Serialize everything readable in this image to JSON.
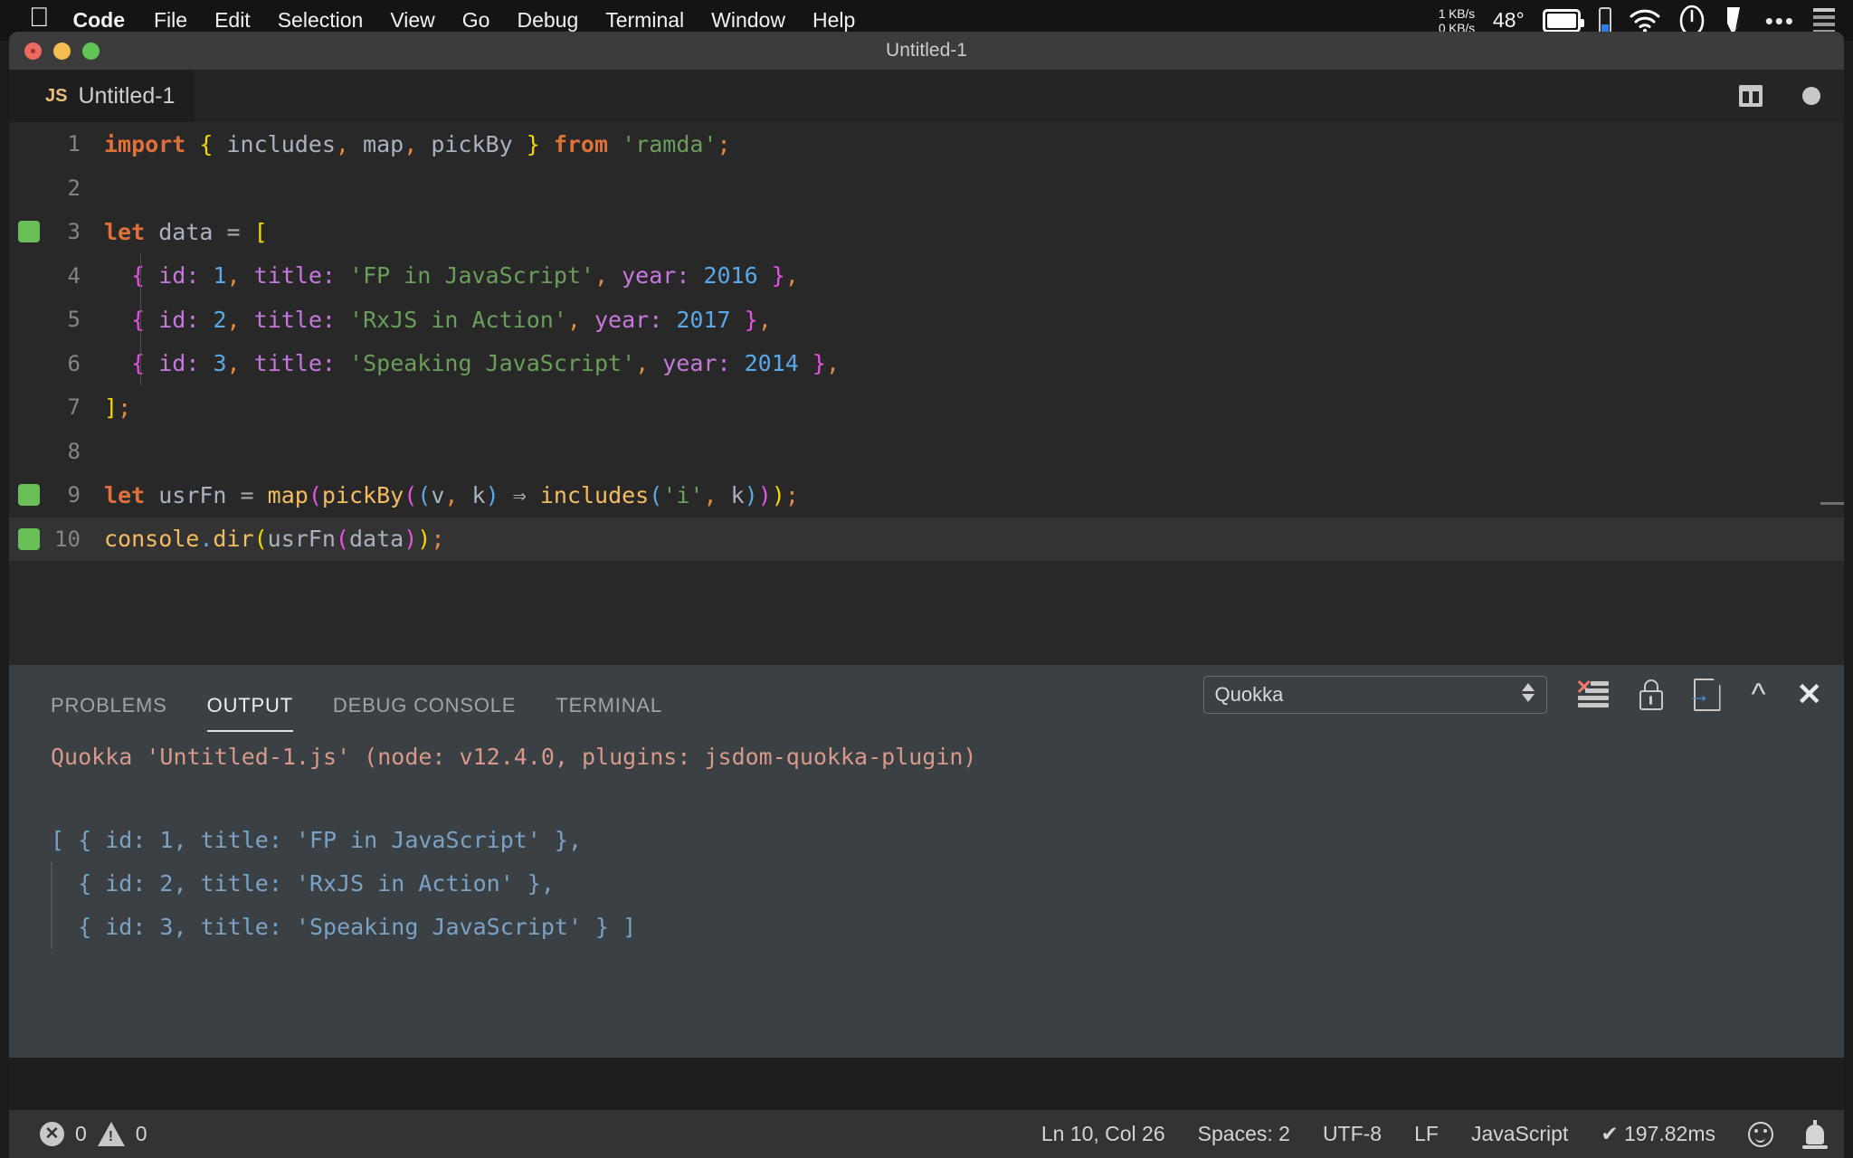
{
  "menubar": {
    "apple_icon": "apple-logo-icon",
    "items": [
      "Code",
      "File",
      "Edit",
      "Selection",
      "View",
      "Go",
      "Debug",
      "Terminal",
      "Window",
      "Help"
    ],
    "status": {
      "net_up": "1 KB/s",
      "net_down": "0 KB/s",
      "temperature": "48°",
      "icons": [
        "display-icon",
        "phone-battery-icon",
        "wifi-icon",
        "clock-icon",
        "control-center-icon",
        "ellipsis-icon",
        "list-icon"
      ]
    }
  },
  "window": {
    "title": "Untitled-1",
    "traffic_lights": [
      "close-button",
      "minimize-button",
      "maximize-button"
    ]
  },
  "editor": {
    "tab": {
      "badge": "JS",
      "label": "Untitled-1"
    },
    "actions": [
      "split-editor-icon",
      "unsaved-dot-icon"
    ],
    "lines": [
      {
        "n": "1",
        "marker": null,
        "highlight": false,
        "indent": false,
        "tokens": [
          [
            "kw",
            "import"
          ],
          [
            "plain",
            " "
          ],
          [
            "brace-y",
            "{"
          ],
          [
            "plain",
            " "
          ],
          [
            "var",
            "includes"
          ],
          [
            "punct",
            ","
          ],
          [
            "plain",
            " "
          ],
          [
            "var",
            "map"
          ],
          [
            "punct",
            ","
          ],
          [
            "plain",
            " "
          ],
          [
            "var",
            "pickBy"
          ],
          [
            "plain",
            " "
          ],
          [
            "brace-y",
            "}"
          ],
          [
            "plain",
            " "
          ],
          [
            "kw",
            "from"
          ],
          [
            "plain",
            " "
          ],
          [
            "str",
            "'ramda'"
          ],
          [
            "punct",
            ";"
          ]
        ]
      },
      {
        "n": "2",
        "marker": null,
        "highlight": false,
        "indent": false,
        "tokens": []
      },
      {
        "n": "3",
        "marker": "green",
        "highlight": false,
        "indent": false,
        "tokens": [
          [
            "kw",
            "let"
          ],
          [
            "plain",
            " "
          ],
          [
            "var",
            "data"
          ],
          [
            "plain",
            " "
          ],
          [
            "op",
            "="
          ],
          [
            "plain",
            " "
          ],
          [
            "brace-y",
            "["
          ]
        ]
      },
      {
        "n": "4",
        "marker": null,
        "highlight": false,
        "indent": true,
        "tokens": [
          [
            "plain",
            "  "
          ],
          [
            "brace-m",
            "{"
          ],
          [
            "plain",
            " "
          ],
          [
            "prop",
            "id"
          ],
          [
            "prop",
            ":"
          ],
          [
            "plain",
            " "
          ],
          [
            "num",
            "1"
          ],
          [
            "punct",
            ","
          ],
          [
            "plain",
            " "
          ],
          [
            "prop",
            "title"
          ],
          [
            "prop",
            ":"
          ],
          [
            "plain",
            " "
          ],
          [
            "str",
            "'FP in JavaScript'"
          ],
          [
            "punct",
            ","
          ],
          [
            "plain",
            " "
          ],
          [
            "prop",
            "year"
          ],
          [
            "prop",
            ":"
          ],
          [
            "plain",
            " "
          ],
          [
            "num",
            "2016"
          ],
          [
            "plain",
            " "
          ],
          [
            "brace-m",
            "}"
          ],
          [
            "punct",
            ","
          ]
        ]
      },
      {
        "n": "5",
        "marker": null,
        "highlight": false,
        "indent": true,
        "tokens": [
          [
            "plain",
            "  "
          ],
          [
            "brace-m",
            "{"
          ],
          [
            "plain",
            " "
          ],
          [
            "prop",
            "id"
          ],
          [
            "prop",
            ":"
          ],
          [
            "plain",
            " "
          ],
          [
            "num",
            "2"
          ],
          [
            "punct",
            ","
          ],
          [
            "plain",
            " "
          ],
          [
            "prop",
            "title"
          ],
          [
            "prop",
            ":"
          ],
          [
            "plain",
            " "
          ],
          [
            "str",
            "'RxJS in Action'"
          ],
          [
            "punct",
            ","
          ],
          [
            "plain",
            " "
          ],
          [
            "prop",
            "year"
          ],
          [
            "prop",
            ":"
          ],
          [
            "plain",
            " "
          ],
          [
            "num",
            "2017"
          ],
          [
            "plain",
            " "
          ],
          [
            "brace-m",
            "}"
          ],
          [
            "punct",
            ","
          ]
        ]
      },
      {
        "n": "6",
        "marker": null,
        "highlight": false,
        "indent": true,
        "tokens": [
          [
            "plain",
            "  "
          ],
          [
            "brace-m",
            "{"
          ],
          [
            "plain",
            " "
          ],
          [
            "prop",
            "id"
          ],
          [
            "prop",
            ":"
          ],
          [
            "plain",
            " "
          ],
          [
            "num",
            "3"
          ],
          [
            "punct",
            ","
          ],
          [
            "plain",
            " "
          ],
          [
            "prop",
            "title"
          ],
          [
            "prop",
            ":"
          ],
          [
            "plain",
            " "
          ],
          [
            "str",
            "'Speaking JavaScript'"
          ],
          [
            "punct",
            ","
          ],
          [
            "plain",
            " "
          ],
          [
            "prop",
            "year"
          ],
          [
            "prop",
            ":"
          ],
          [
            "plain",
            " "
          ],
          [
            "num",
            "2014"
          ],
          [
            "plain",
            " "
          ],
          [
            "brace-m",
            "}"
          ],
          [
            "punct",
            ","
          ]
        ]
      },
      {
        "n": "7",
        "marker": null,
        "highlight": false,
        "indent": false,
        "tokens": [
          [
            "brace-y",
            "]"
          ],
          [
            "punct",
            ";"
          ]
        ]
      },
      {
        "n": "8",
        "marker": null,
        "highlight": false,
        "indent": false,
        "tokens": []
      },
      {
        "n": "9",
        "marker": "green",
        "highlight": false,
        "indent": false,
        "tokens": [
          [
            "kw",
            "let"
          ],
          [
            "plain",
            " "
          ],
          [
            "var",
            "usrFn"
          ],
          [
            "plain",
            " "
          ],
          [
            "op",
            "="
          ],
          [
            "plain",
            " "
          ],
          [
            "fn",
            "map"
          ],
          [
            "brace-m",
            "("
          ],
          [
            "fn",
            "pickBy"
          ],
          [
            "brace-m",
            "("
          ],
          [
            "brace-b",
            "("
          ],
          [
            "var",
            "v"
          ],
          [
            "punct",
            ","
          ],
          [
            "plain",
            " "
          ],
          [
            "var",
            "k"
          ],
          [
            "brace-b",
            ")"
          ],
          [
            "plain",
            " "
          ],
          [
            "op",
            "⇒"
          ],
          [
            "plain",
            " "
          ],
          [
            "fn",
            "includes"
          ],
          [
            "brace-b",
            "("
          ],
          [
            "str",
            "'i'"
          ],
          [
            "punct",
            ","
          ],
          [
            "plain",
            " "
          ],
          [
            "var",
            "k"
          ],
          [
            "brace-b",
            ")"
          ],
          [
            "brace-m",
            ")"
          ],
          [
            "brace-y",
            ")"
          ],
          [
            "punct",
            ";"
          ]
        ]
      },
      {
        "n": "10",
        "marker": "green",
        "highlight": true,
        "indent": false,
        "tokens": [
          [
            "fn",
            "console"
          ],
          [
            "brace-b",
            "."
          ],
          [
            "fn",
            "dir"
          ],
          [
            "brace-y",
            "("
          ],
          [
            "var",
            "usrFn"
          ],
          [
            "brace-m",
            "("
          ],
          [
            "var",
            "data"
          ],
          [
            "brace-m",
            ")"
          ],
          [
            "brace-y",
            ")"
          ],
          [
            "punct",
            ";"
          ]
        ]
      }
    ]
  },
  "panel": {
    "tabs": [
      {
        "label": "PROBLEMS",
        "active": false
      },
      {
        "label": "OUTPUT",
        "active": true
      },
      {
        "label": "DEBUG CONSOLE",
        "active": false
      },
      {
        "label": "TERMINAL",
        "active": false
      }
    ],
    "channel_select": {
      "value": "Quokka"
    },
    "toolbar_icons": [
      "clear-output-icon",
      "lock-scroll-icon",
      "open-in-editor-icon",
      "maximize-panel-icon",
      "close-panel-icon"
    ],
    "output": {
      "header": "Quokka 'Untitled-1.js' (node: v12.4.0, plugins: jsdom-quokka-plugin)",
      "lines": [
        "[ { id: 1, title: 'FP in JavaScript' },",
        "  { id: 2, title: 'RxJS in Action' },",
        "  { id: 3, title: 'Speaking JavaScript' } ]"
      ]
    }
  },
  "statusbar": {
    "errors": "0",
    "warnings": "0",
    "cursor": "Ln 10, Col 26",
    "spaces": "Spaces: 2",
    "encoding": "UTF-8",
    "eol": "LF",
    "language": "JavaScript",
    "runtime": "✔ 197.82ms",
    "icons": [
      "error-icon",
      "warning-icon",
      "feedback-smiley-icon",
      "notification-bell-icon"
    ]
  },
  "colors": {
    "editor_bg": "#282828",
    "panel_bg": "#3b4045",
    "statusbar_bg": "#333333",
    "marker_green": "#6bbf59",
    "output_text": "#7ba2c4",
    "output_header": "#d8998a"
  }
}
